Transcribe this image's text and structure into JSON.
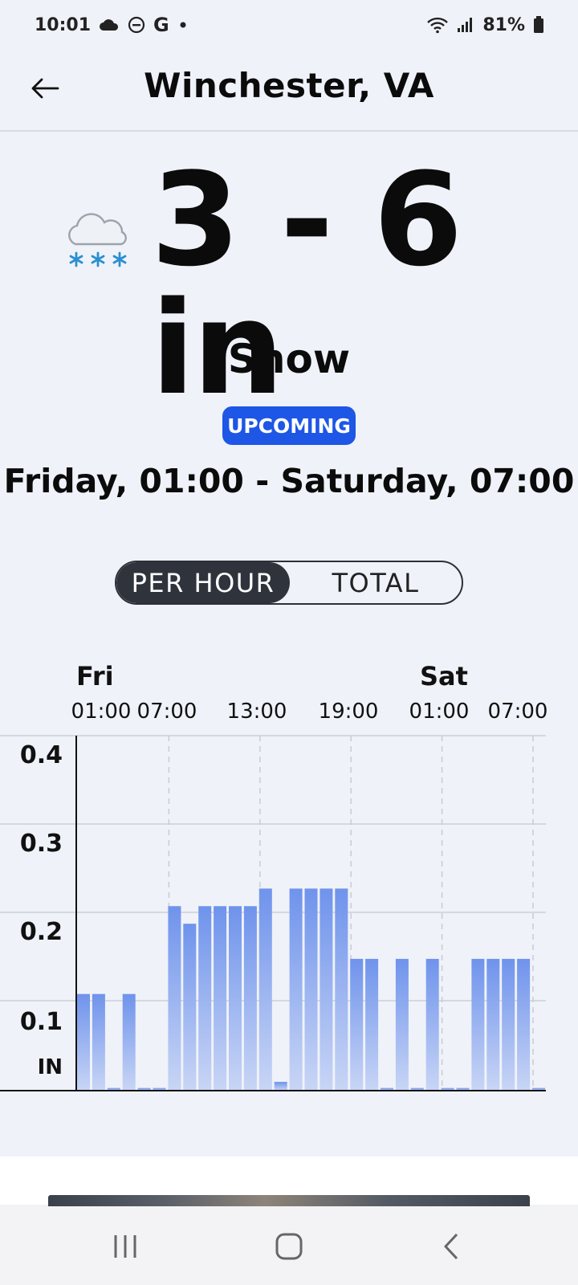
{
  "status_bar": {
    "time": "10:01",
    "battery": "81%",
    "icons": [
      "cloud-icon",
      "do-not-disturb-icon",
      "google-icon",
      "dot-icon",
      "wifi-icon",
      "signal-icon",
      "battery-icon"
    ]
  },
  "header": {
    "title": "Winchester, VA",
    "back_icon": "arrow-left-icon"
  },
  "forecast": {
    "amount": "3 - 6 in",
    "condition": "Snow",
    "badge": "UPCOMING",
    "timespan": "Friday, 01:00 - Saturday, 07:00",
    "icon": "snow-cloud-icon",
    "colors": {
      "badge": "#1e56e6",
      "snowflake": "#2a8fd1"
    }
  },
  "toggle": {
    "per_hour": "PER HOUR",
    "total": "TOTAL",
    "selected": "PER HOUR"
  },
  "chart_data": {
    "type": "bar",
    "day_labels": [
      "Fri",
      "Sat"
    ],
    "x_tick_labels": [
      "01:00",
      "07:00",
      "13:00",
      "19:00",
      "01:00",
      "07:00"
    ],
    "y_tick_labels": [
      "0.4",
      "0.3",
      "0.2",
      "0.1"
    ],
    "y_unit": "IN",
    "ylim": [
      0,
      0.4
    ],
    "grid": true,
    "bar_color": "#6f93ec",
    "values": [
      0.11,
      0.11,
      0.003,
      0.11,
      0.003,
      0.003,
      0.21,
      0.19,
      0.21,
      0.21,
      0.21,
      0.21,
      0.23,
      0.01,
      0.23,
      0.23,
      0.23,
      0.23,
      0.15,
      0.15,
      0.003,
      0.15,
      0.003,
      0.15,
      0.003,
      0.003,
      0.15,
      0.15,
      0.15,
      0.15,
      0.003
    ]
  },
  "nav_bar": {
    "icons": [
      "recent-apps-icon",
      "home-icon",
      "back-icon"
    ]
  }
}
